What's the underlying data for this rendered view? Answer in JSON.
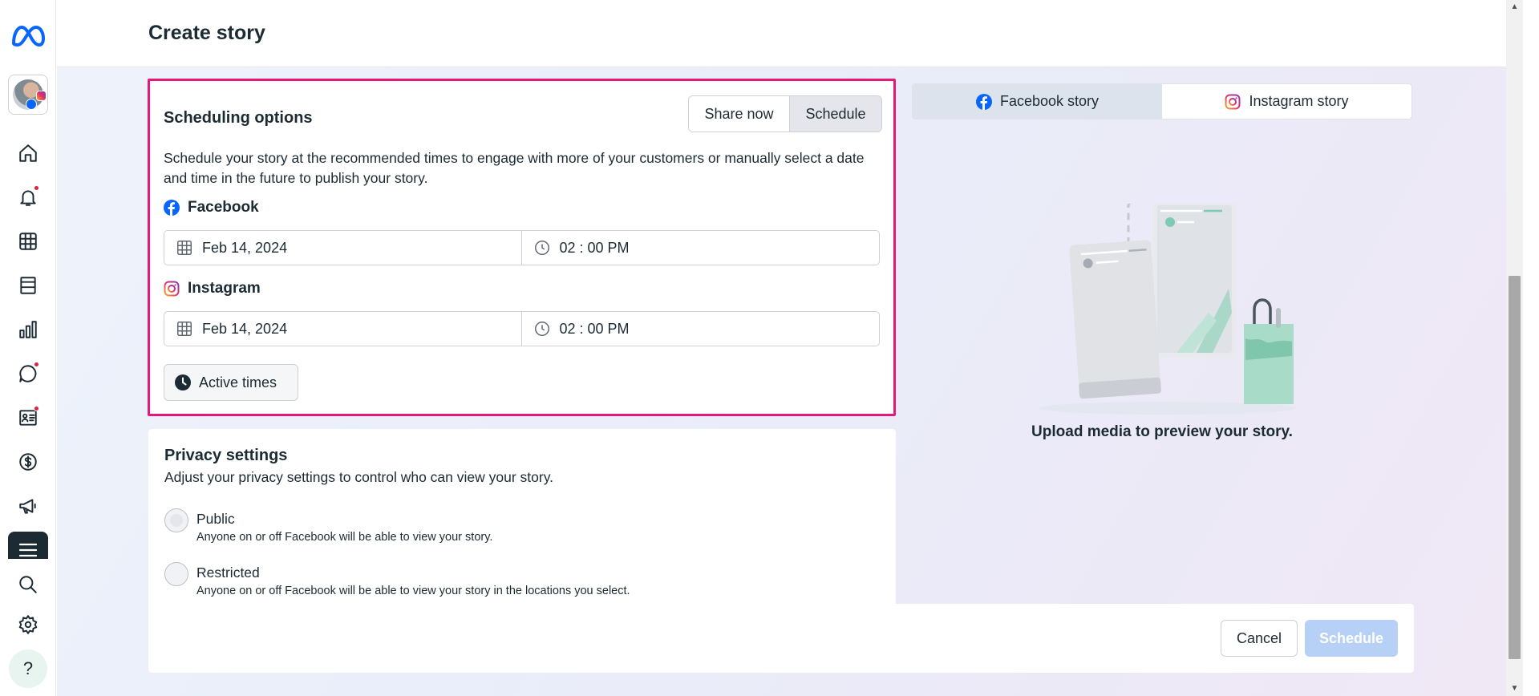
{
  "header": {
    "title": "Create story"
  },
  "rail": {
    "items": [
      {
        "name": "home-icon"
      },
      {
        "name": "bell-icon",
        "badge": true
      },
      {
        "name": "grid-icon"
      },
      {
        "name": "posts-icon"
      },
      {
        "name": "insights-icon"
      },
      {
        "name": "chat-icon",
        "badge": true
      },
      {
        "name": "contact-card-icon",
        "badge": true
      },
      {
        "name": "dollar-icon"
      },
      {
        "name": "megaphone-icon"
      },
      {
        "name": "menu-icon"
      },
      {
        "name": "search-icon"
      },
      {
        "name": "gear-icon"
      }
    ],
    "help": "?"
  },
  "scheduling": {
    "title": "Scheduling options",
    "toggle": {
      "share_now": "Share now",
      "schedule": "Schedule",
      "selected": "Schedule"
    },
    "description": "Schedule your story at the recommended times to engage with more of your customers or manually select a date and time in the future to publish your story.",
    "facebook": {
      "label": "Facebook",
      "date": "Feb 14, 2024",
      "time": "02 : 00 PM"
    },
    "instagram": {
      "label": "Instagram",
      "date": "Feb 14, 2024",
      "time": "02 : 00 PM"
    },
    "active_times": "Active times"
  },
  "privacy": {
    "title": "Privacy settings",
    "subtitle": "Adjust your privacy settings to control who can view your story.",
    "options": [
      {
        "label": "Public",
        "desc": "Anyone on or off Facebook will be able to view your story."
      },
      {
        "label": "Restricted",
        "desc": "Anyone on or off Facebook will be able to view your story in the locations you select."
      }
    ]
  },
  "preview": {
    "tabs": [
      "Facebook story",
      "Instagram story"
    ],
    "active_tab": "Facebook story",
    "empty_text": "Upload media to preview your story."
  },
  "footer": {
    "cancel": "Cancel",
    "schedule": "Schedule"
  },
  "colors": {
    "highlight": "#e6187e",
    "facebook_blue": "#0866ff",
    "schedule_disabled": "#b7d1f6"
  }
}
